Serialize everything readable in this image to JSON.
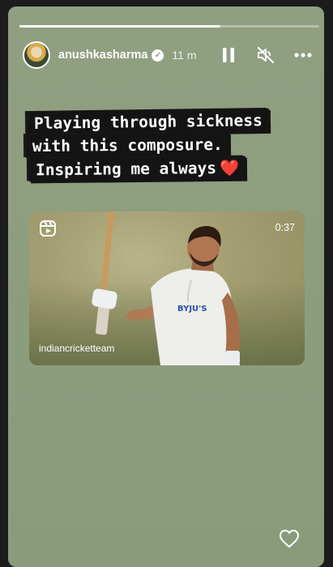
{
  "story": {
    "progress": 0.67,
    "username": "anushkasharma",
    "verified": true,
    "timestamp": "11 m",
    "controls": [
      "pause-icon",
      "muted-icon",
      "more-icon"
    ]
  },
  "caption": {
    "line1": "Playing through sickness",
    "line2": "with this composure.",
    "line3": "Inspiring me always",
    "emoji": "❤️"
  },
  "video": {
    "duration": "0:37",
    "source": "indiancricketteam",
    "type_icon": "reels-icon"
  },
  "like_icon": "heart-outline-icon"
}
